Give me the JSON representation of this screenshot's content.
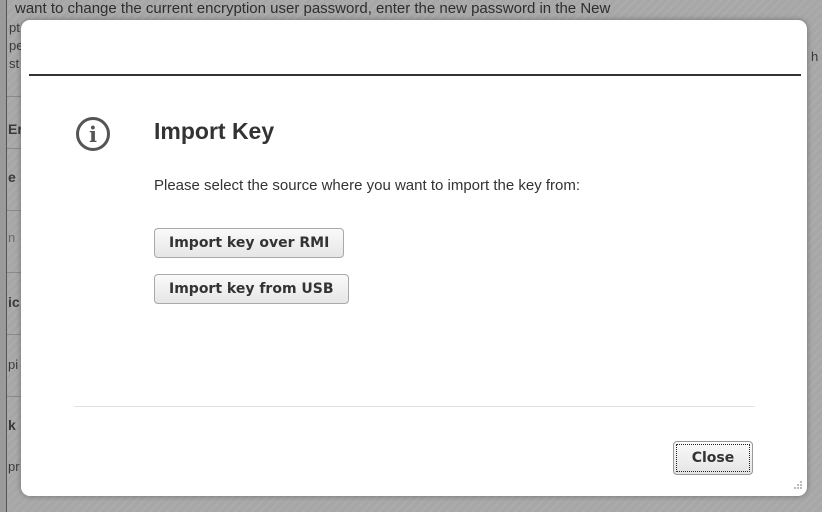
{
  "background": {
    "top_text": "want to change the current encryption user password, enter the new password in the New",
    "fragments": [
      "pt",
      "pe",
      "st",
      "Er",
      "e",
      "n",
      "ic",
      "pi",
      "k",
      "pr",
      "h"
    ]
  },
  "dialog": {
    "title": "Import Key",
    "message": "Please select the source where you want to import the key from:",
    "buttons": {
      "import_rmi": "Import key over RMI",
      "import_usb": "Import key from USB",
      "close": "Close"
    },
    "icon": "info-icon"
  },
  "colors": {
    "overlay_bg": "#a7a7a7",
    "dialog_bg": "#ffffff",
    "title_text": "#333333",
    "header_rule": "#333333"
  }
}
